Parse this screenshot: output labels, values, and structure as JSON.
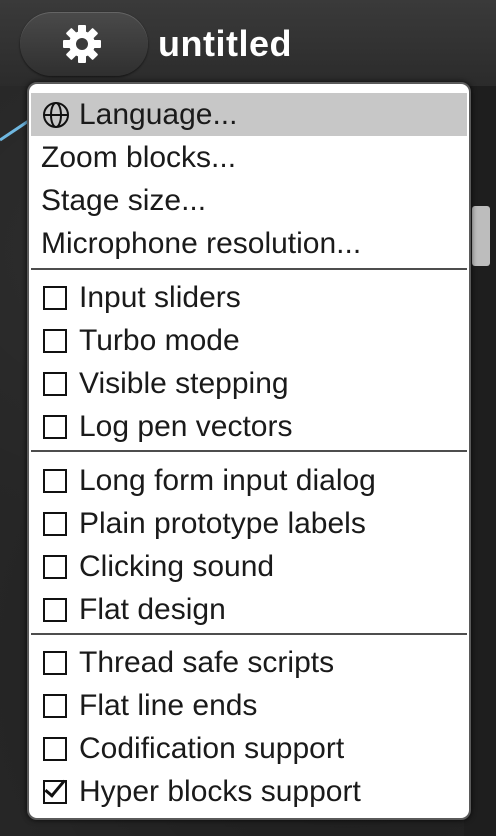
{
  "topbar": {
    "title": "untitled",
    "settings_icon": "gear-icon"
  },
  "menu": {
    "groups": [
      {
        "items": [
          {
            "label": "Language...",
            "icon": "globe-icon",
            "highlighted": true
          },
          {
            "label": "Zoom blocks..."
          },
          {
            "label": "Stage size..."
          },
          {
            "label": "Microphone resolution..."
          }
        ]
      },
      {
        "items": [
          {
            "label": "Input sliders",
            "checked": false
          },
          {
            "label": "Turbo mode",
            "checked": false
          },
          {
            "label": "Visible stepping",
            "checked": false
          },
          {
            "label": "Log pen vectors",
            "checked": false
          }
        ]
      },
      {
        "items": [
          {
            "label": "Long form input dialog",
            "checked": false
          },
          {
            "label": "Plain prototype labels",
            "checked": false
          },
          {
            "label": "Clicking sound",
            "checked": false
          },
          {
            "label": "Flat design",
            "checked": false
          }
        ]
      },
      {
        "items": [
          {
            "label": "Thread safe scripts",
            "checked": false
          },
          {
            "label": "Flat line ends",
            "checked": false
          },
          {
            "label": "Codification support",
            "checked": false
          },
          {
            "label": "Hyper blocks support",
            "checked": true
          }
        ]
      }
    ]
  },
  "colors": {
    "highlight": "#c7c7c7",
    "menu_bg": "#ffffff",
    "topbar_bg": "#333333"
  }
}
